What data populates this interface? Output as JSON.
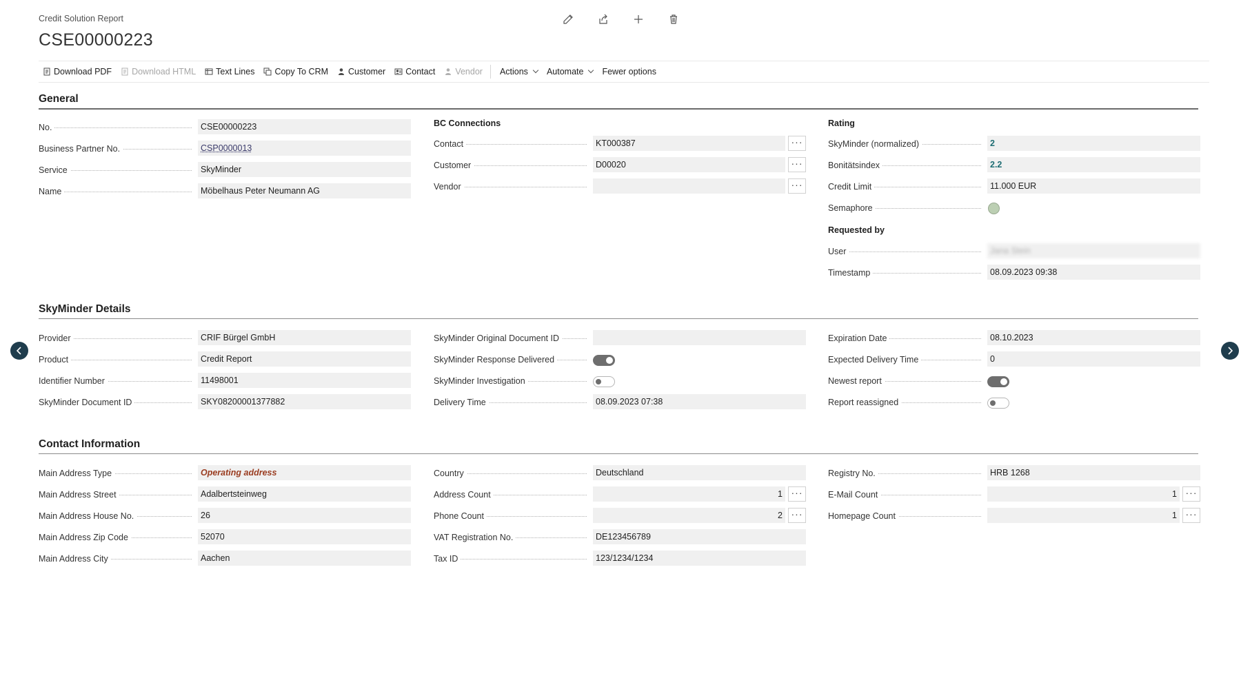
{
  "page": {
    "breadcrumb": "Credit Solution Report",
    "title": "CSE00000223"
  },
  "header_icons": [
    "pencil-icon",
    "share-icon",
    "plus-icon",
    "trash-icon"
  ],
  "actions": [
    {
      "label": "Download PDF",
      "icon": "document-icon",
      "disabled": false
    },
    {
      "label": "Download HTML",
      "icon": "document-icon",
      "disabled": true
    },
    {
      "label": "Text Lines",
      "icon": "table-icon",
      "disabled": false
    },
    {
      "label": "Copy To CRM",
      "icon": "copy-icon",
      "disabled": false
    },
    {
      "label": "Customer",
      "icon": "person-icon",
      "disabled": false
    },
    {
      "label": "Contact",
      "icon": "contact-card-icon",
      "disabled": false
    },
    {
      "label": "Vendor",
      "icon": "person-icon",
      "disabled": true
    },
    {
      "label": "Actions",
      "dropdown": true
    },
    {
      "label": "Automate",
      "dropdown": true
    },
    {
      "label": "Fewer options"
    }
  ],
  "general": {
    "title": "General",
    "left": [
      {
        "label": "No.",
        "value": "CSE00000223"
      },
      {
        "label": "Business Partner No.",
        "value": "CSP0000013"
      },
      {
        "label": "Service",
        "value": "SkyMinder"
      },
      {
        "label": "Name",
        "value": "Möbelhaus Peter Neumann AG"
      }
    ],
    "bc_connections": {
      "heading": "BC Connections",
      "fields": [
        {
          "label": "Contact",
          "value": "KT000387"
        },
        {
          "label": "Customer",
          "value": "D00020"
        },
        {
          "label": "Vendor",
          "value": ""
        }
      ]
    },
    "rating": {
      "heading": "Rating",
      "fields": [
        {
          "label": "SkyMinder (normalized)",
          "value": "2"
        },
        {
          "label": "Bonitätsindex",
          "value": "2.2"
        },
        {
          "label": "Credit Limit",
          "value": "11.000 EUR"
        },
        {
          "label": "Semaphore",
          "value": ""
        }
      ],
      "semaphore_color": "#bccfb3"
    },
    "requested_by": {
      "heading": "Requested by",
      "fields": [
        {
          "label": "User",
          "value": "Jana Stein"
        },
        {
          "label": "Timestamp",
          "value": "08.09.2023 09:38"
        }
      ]
    }
  },
  "skyminder": {
    "title": "SkyMinder Details",
    "left": [
      {
        "label": "Provider",
        "value": "CRIF Bürgel GmbH"
      },
      {
        "label": "Product",
        "value": "Credit Report"
      },
      {
        "label": "Identifier Number",
        "value": "11498001"
      },
      {
        "label": "SkyMinder Document ID",
        "value": "SKY08200001377882"
      }
    ],
    "middle": [
      {
        "label": "SkyMinder Original Document ID",
        "value": ""
      },
      {
        "label": "SkyMinder Response Delivered",
        "toggle": true
      },
      {
        "label": "SkyMinder Investigation",
        "toggle": false
      },
      {
        "label": "Delivery Time",
        "value": "08.09.2023 07:38"
      }
    ],
    "right": [
      {
        "label": "Expiration Date",
        "value": "08.10.2023"
      },
      {
        "label": "Expected Delivery Time",
        "value": "0"
      },
      {
        "label": "Newest report",
        "toggle": true
      },
      {
        "label": "Report reassigned",
        "toggle": false
      }
    ]
  },
  "contact": {
    "title": "Contact Information",
    "left": [
      {
        "label": "Main Address Type",
        "value": "Operating address"
      },
      {
        "label": "Main Address Street",
        "value": "Adalbertsteinweg"
      },
      {
        "label": "Main Address House No.",
        "value": "26"
      },
      {
        "label": "Main Address Zip Code",
        "value": "52070"
      },
      {
        "label": "Main Address City",
        "value": "Aachen"
      }
    ],
    "middle": [
      {
        "label": "Country",
        "value": "Deutschland"
      },
      {
        "label": "Address Count",
        "value": "1"
      },
      {
        "label": "Phone Count",
        "value": "2"
      },
      {
        "label": "VAT Registration No.",
        "value": "DE123456789"
      },
      {
        "label": "Tax ID",
        "value": "123/1234/1234"
      }
    ],
    "right": [
      {
        "label": "Registry No.",
        "value": "HRB 1268"
      },
      {
        "label": "E-Mail Count",
        "value": "1"
      },
      {
        "label": "Homepage Count",
        "value": "1"
      }
    ]
  },
  "assist_button_label": "···",
  "colors": {
    "accent_teal": "#1f6e74",
    "emphasis": "#9a3c20",
    "nav_arrow": "#1f3d4d"
  }
}
